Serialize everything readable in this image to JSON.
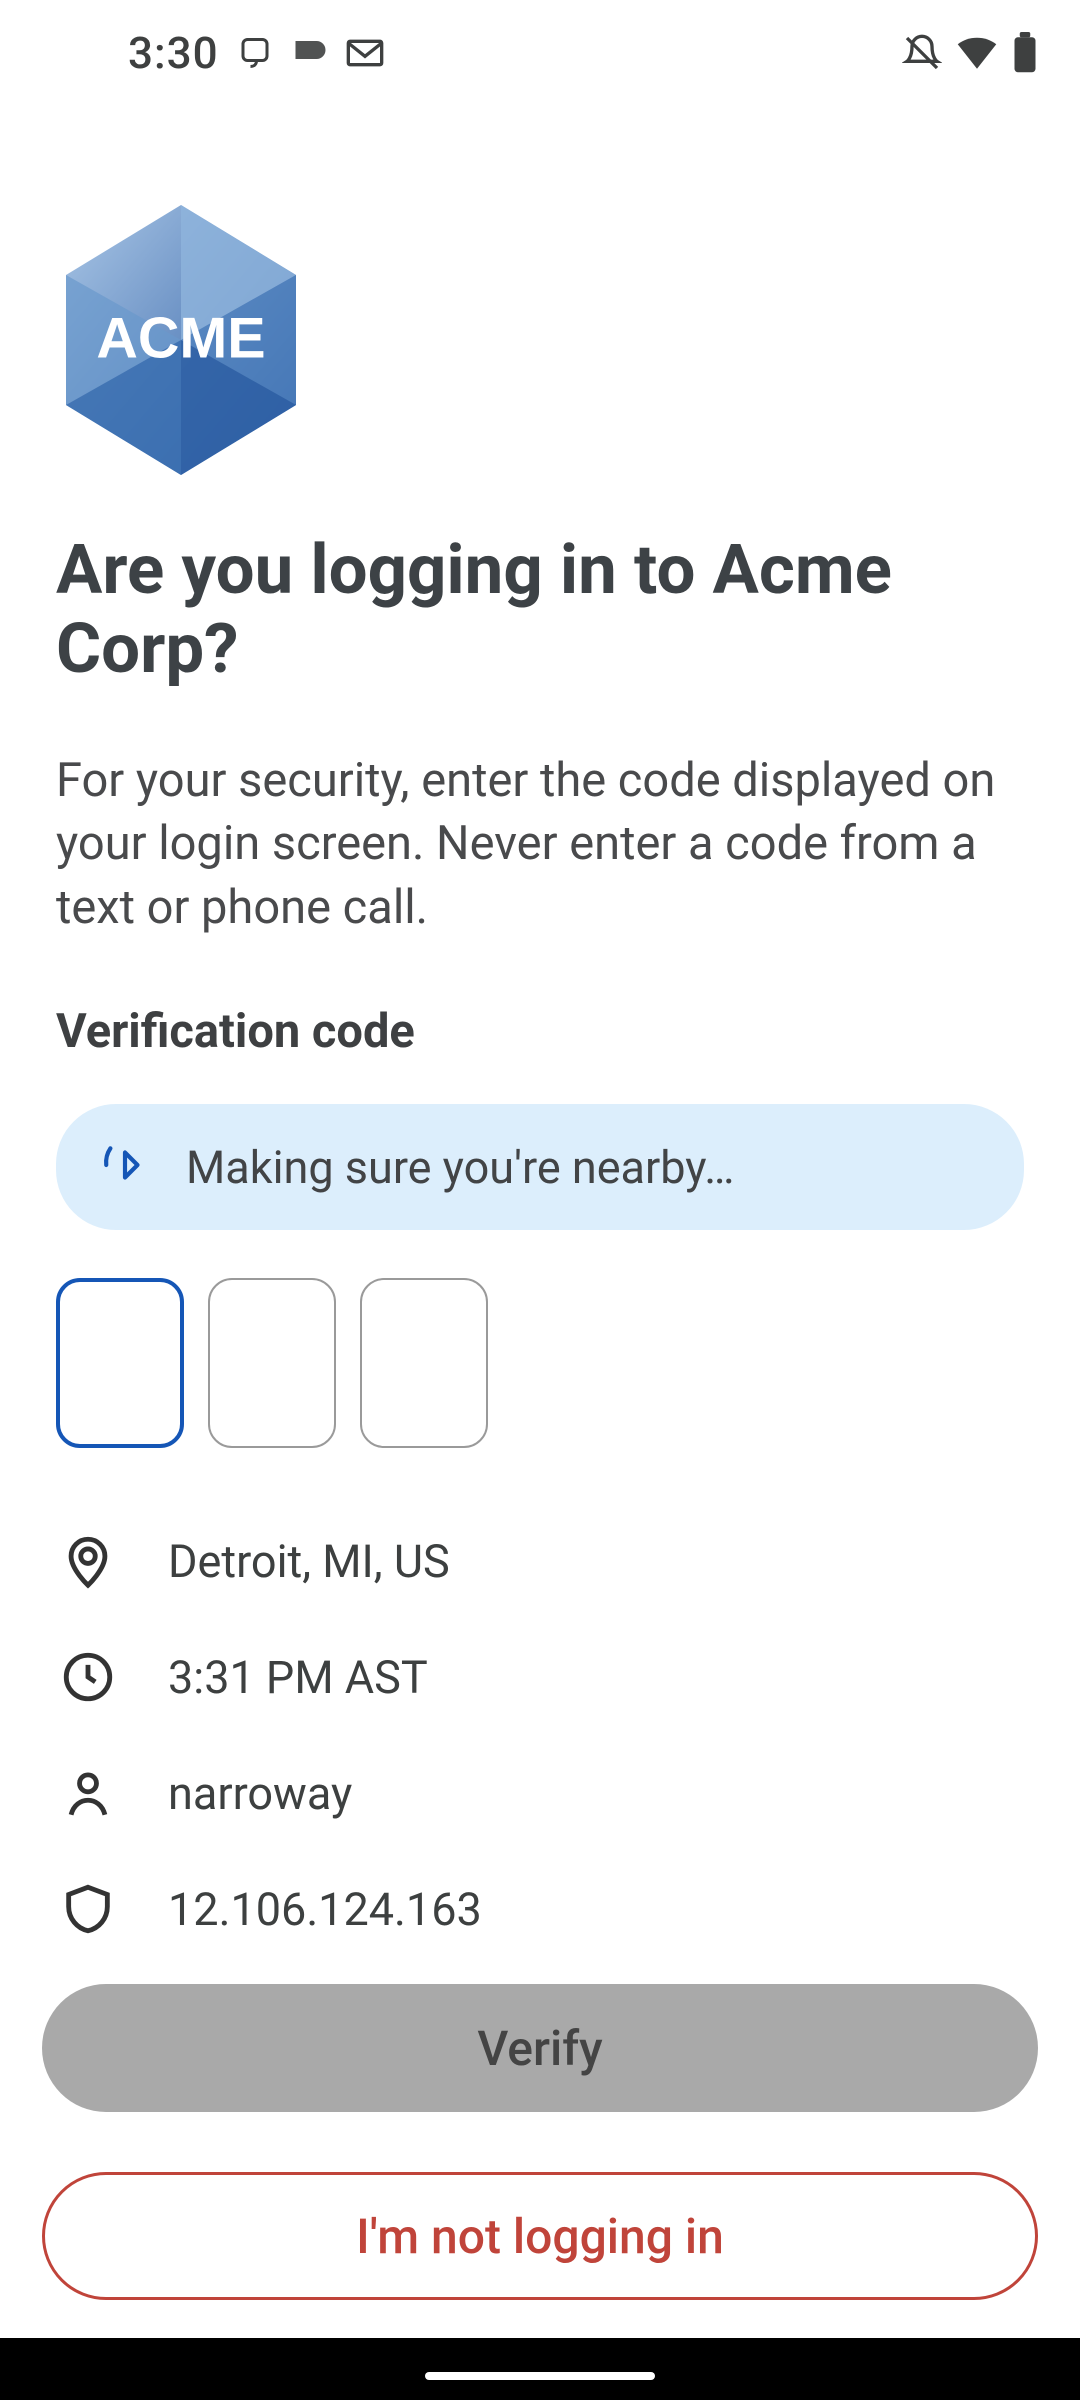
{
  "status": {
    "time": "3:30",
    "icons_left": [
      "duo-icon",
      "arc-icon",
      "gmail-icon"
    ],
    "icons_right": [
      "notifications-off-icon",
      "wifi-icon",
      "battery-icon"
    ]
  },
  "logo_text": "ACME",
  "title": "Are you logging in to Acme Corp?",
  "subtitle": "For your security, enter the code displayed on your login screen. Never enter a code from a text or phone call.",
  "section_label": "Verification code",
  "proximity_text": "Making sure you're nearby…",
  "code_inputs": [
    "",
    "",
    ""
  ],
  "info": {
    "location": "Detroit, MI, US",
    "time": "3:31 PM AST",
    "user": "narroway",
    "ip": "12.106.124.163"
  },
  "buttons": {
    "verify": "Verify",
    "deny": "I'm not logging in"
  }
}
